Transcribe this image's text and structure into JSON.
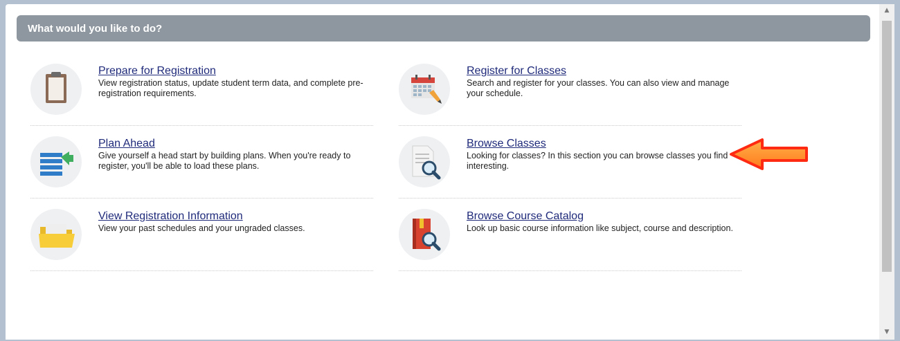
{
  "header": {
    "title": "What would you like to do?"
  },
  "tiles": [
    {
      "title": "Prepare for Registration",
      "description": "View registration status, update student term data, and complete pre-registration requirements.",
      "icon": "clipboard-icon"
    },
    {
      "title": "Register for Classes",
      "description": "Search and register for your classes. You can also view and manage your schedule.",
      "icon": "calendar-pencil-icon"
    },
    {
      "title": "Plan Ahead",
      "description": "Give yourself a head start by building plans. When you're ready to register, you'll be able to load these plans.",
      "icon": "list-plan-icon"
    },
    {
      "title": "Browse Classes",
      "description": "Looking for classes? In this section you can browse classes you find interesting.",
      "icon": "document-magnifier-icon"
    },
    {
      "title": "View Registration Information",
      "description": "View your past schedules and your ungraded classes.",
      "icon": "folder-icon"
    },
    {
      "title": "Browse Course Catalog",
      "description": "Look up basic course information like subject, course and description.",
      "icon": "book-magnifier-icon"
    }
  ],
  "scrollbar": {
    "up_arrow": "▲",
    "down_arrow": "▼"
  },
  "colors": {
    "header_bg": "#8e979f",
    "link": "#1f2a7a",
    "annotation_arrow": "#ff3b1a"
  }
}
